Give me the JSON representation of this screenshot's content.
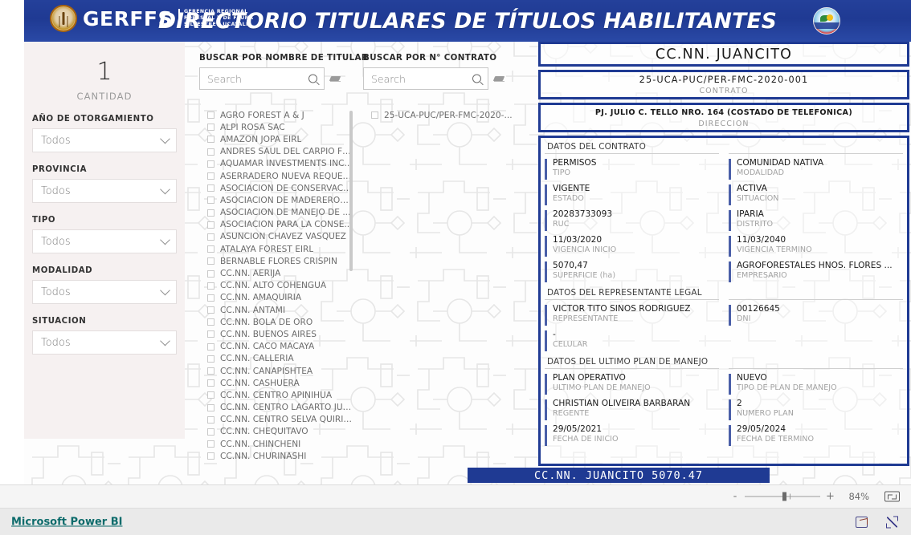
{
  "header": {
    "brand": "GERFFS",
    "brand_sub_line1": "GERENCIA  REGIONAL",
    "brand_sub_line2": "FORESTAL Y DE FAUNA",
    "brand_sub_line3": "SILVESTRE  -  UCAYALI",
    "title": "DIRECTORIO TITULARES DE TÍTULOS HABILITANTES",
    "accent_color": "#1f3a93"
  },
  "sidebar": {
    "count_value": "1",
    "count_label": "CANTIDAD",
    "filters": [
      {
        "label": "AÑO DE OTORGAMIENTO",
        "value": "Todos"
      },
      {
        "label": "PROVINCIA",
        "value": "Todos"
      },
      {
        "label": "TIPO",
        "value": "Todos"
      },
      {
        "label": "MODALIDAD",
        "value": "Todos"
      },
      {
        "label": "SITUACION",
        "value": "Todos"
      }
    ]
  },
  "search": {
    "titular": {
      "label": "BUSCAR POR NOMBRE DE TITULAR",
      "placeholder": "Search",
      "value": ""
    },
    "contrato": {
      "label": "BUSCAR POR N° CONTRATO",
      "placeholder": "Search",
      "value": ""
    }
  },
  "titular_list": [
    "AGRO FOREST A & J",
    "ALPI ROSA SAC",
    "AMAZON JOPA EIRL",
    "ANDRES SAUL DEL CARPIO FE...",
    "AQUAMAR INVESTMENTS INC...",
    "ASERRADERO NUEVA REQUEN...",
    "ASOCIACION DE CONSERVACI...",
    "ASOCIACION DE MADEREROS ...",
    "ASOCIACION DE MANEJO DE ...",
    "ASOCIACION PARA LA CONSE...",
    "ASUNCION CHAVEZ VASQUEZ",
    "ATALAYA FOREST EIRL",
    "BERNABLE FLORES CRISPIN",
    "CC.NN. AERIJA",
    "CC.NN. ALTO COHENGUA",
    "CC.NN. AMAQUIRIA",
    "CC.NN. ANTAMI",
    "CC.NN. BOLA DE ORO",
    "CC.NN. BUENOS AIRES",
    "CC.NN. CACO MACAYA",
    "CC.NN. CALLERIA",
    "CC.NN. CANAPISHTEA",
    "CC.NN. CASHUERA",
    "CC.NN. CENTRO APINIHUA",
    "CC.NN. CENTRO LAGARTO JUV...",
    "CC.NN. CENTRO SELVA QUIRIS...",
    "CC.NN. CHEQUITAVO",
    "CC.NN. CHINCHENI",
    "CC.NN. CHURINASHI"
  ],
  "contrato_list": [
    "25-UCA-PUC/PER-FMC-2020-..."
  ],
  "detail": {
    "titular_name": "CC.NN. JUANCITO",
    "contrato_value": "25-UCA-PUC/PER-FMC-2020-001",
    "contrato_label": "CONTRATO",
    "direccion_value": "PJ. JULIO C. TELLO NRO. 164 (COSTADO DE TELEFONICA)",
    "direccion_label": "DIRECCION",
    "sections": [
      {
        "heading": "DATOS DEL CONTRATO",
        "left": [
          {
            "value": "PERMISOS",
            "label": "TIPO"
          },
          {
            "value": "VIGENTE",
            "label": "ESTADO"
          },
          {
            "value": "20283733093",
            "label": "RUC"
          },
          {
            "value": "11/03/2020",
            "label": "VIGENCIA INICIO"
          },
          {
            "value": "5070,47",
            "label": "SUPERFICIE (ha)"
          }
        ],
        "right": [
          {
            "value": "COMUNIDAD NATIVA",
            "label": "MODALIDAD"
          },
          {
            "value": "ACTIVA",
            "label": "SITUACION"
          },
          {
            "value": "IPARIA",
            "label": "DISTRITO"
          },
          {
            "value": "11/03/2040",
            "label": "VIGENCIA TERMINO"
          },
          {
            "value": "AGROFORESTALES HNOS. FLORES ...",
            "label": "EMPRESARIO"
          }
        ]
      },
      {
        "heading": "DATOS DEL REPRESENTANTE LEGAL",
        "left": [
          {
            "value": "VICTOR TITO SIÑOS RODRIGUEZ",
            "label": "REPRESENTANTE"
          },
          {
            "value": "-",
            "label": "CELULAR"
          }
        ],
        "right": [
          {
            "value": "00126645",
            "label": "DNI"
          }
        ]
      },
      {
        "heading": "DATOS DEL ULTIMO PLAN DE MANEJO",
        "left": [
          {
            "value": "PLAN OPERATIVO",
            "label": "ULTIMO PLAN DE MANEJO"
          },
          {
            "value": "CHRISTIAN OLIVEIRA BARBARAN",
            "label": "REGENTE"
          },
          {
            "value": "29/05/2021",
            "label": "FECHA DE INICIO"
          }
        ],
        "right": [
          {
            "value": "NUEVO",
            "label": "TIPO DE PLAN DE MANEJO"
          },
          {
            "value": "2",
            "label": "NUMERO PLAN"
          },
          {
            "value": "29/05/2024",
            "label": "FECHA DE TERMINO"
          }
        ]
      }
    ]
  },
  "banner": {
    "text": "CC.NN.  JUANCITO  5070.47"
  },
  "statusbar": {
    "zoom_minus": "-",
    "zoom_plus": "+",
    "zoom_percent": "84%"
  },
  "footer": {
    "powerbi_label": "Microsoft Power BI"
  }
}
